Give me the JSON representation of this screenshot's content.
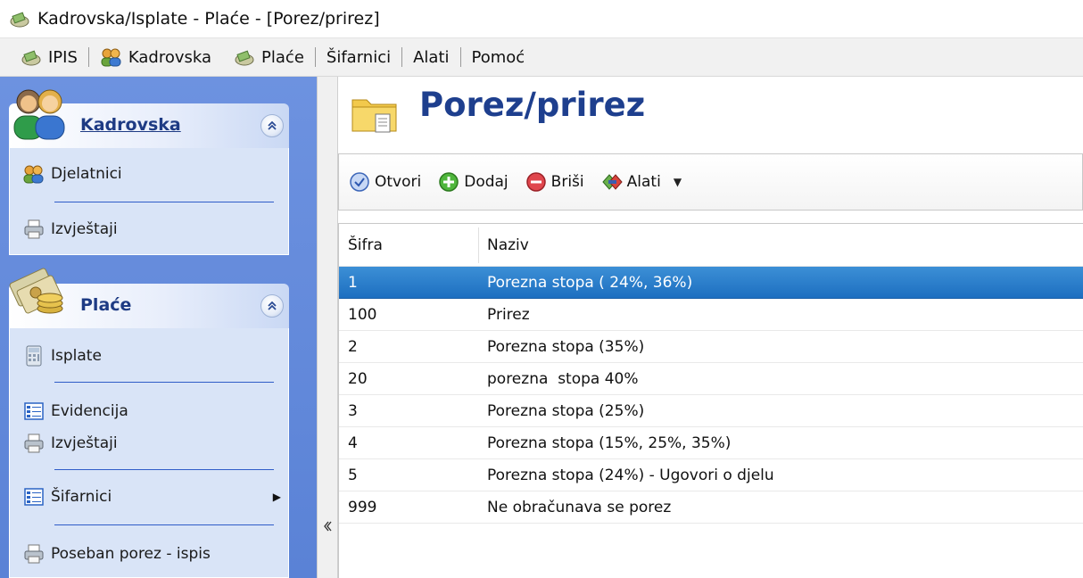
{
  "window": {
    "title": "Kadrovska/Isplate - Plaće - [Porez/prirez]"
  },
  "menu": {
    "items": [
      {
        "label": "IPIS",
        "icon": "ipis-icon"
      },
      {
        "label": "Kadrovska",
        "icon": "users-icon"
      },
      {
        "label": "Plaće",
        "icon": "money-icon"
      },
      {
        "label": "Šifarnici"
      },
      {
        "label": "Alati"
      },
      {
        "label": "Pomoć"
      }
    ]
  },
  "sidebar": {
    "kadrovska": {
      "header": "Kadrovska",
      "items": [
        {
          "label": "Djelatnici",
          "icon": "users-icon"
        },
        {
          "label": "Izvještaji",
          "icon": "printer-icon"
        }
      ]
    },
    "place": {
      "header": "Plaće",
      "items": [
        {
          "label": "Isplate",
          "icon": "calculator-icon"
        },
        {
          "label": "Evidencija",
          "icon": "list-icon"
        },
        {
          "label": "Izvještaji",
          "icon": "printer-icon"
        },
        {
          "label": "Šifarnici",
          "icon": "list-icon"
        },
        {
          "label": "Poseban porez - ispis",
          "icon": "printer-icon"
        }
      ]
    }
  },
  "main": {
    "title": "Porez/prirez",
    "toolbar": {
      "open": "Otvori",
      "add": "Dodaj",
      "delete": "Briši",
      "tools": "Alati"
    },
    "table": {
      "columns": [
        "Šifra",
        "Naziv"
      ],
      "rows": [
        {
          "code": "1",
          "name": "Porezna stopa ( 24%, 36%)",
          "selected": true
        },
        {
          "code": "100",
          "name": "Prirez"
        },
        {
          "code": "2",
          "name": "Porezna stopa (35%)"
        },
        {
          "code": "20",
          "name": "porezna  stopa 40%"
        },
        {
          "code": "3",
          "name": "Porezna stopa (25%)"
        },
        {
          "code": "4",
          "name": "Porezna stopa (15%, 25%, 35%)"
        },
        {
          "code": "5",
          "name": "Porezna stopa (24%) - Ugovori o djelu"
        },
        {
          "code": "999",
          "name": "Ne obračunava se porez"
        }
      ]
    }
  },
  "colors": {
    "sidebar_bg": "#5f86d8",
    "panel_bg": "#d9e4f7",
    "header_text": "#1e3b84",
    "selection": "#1d6fc0",
    "title_text": "#1e3f8e"
  }
}
